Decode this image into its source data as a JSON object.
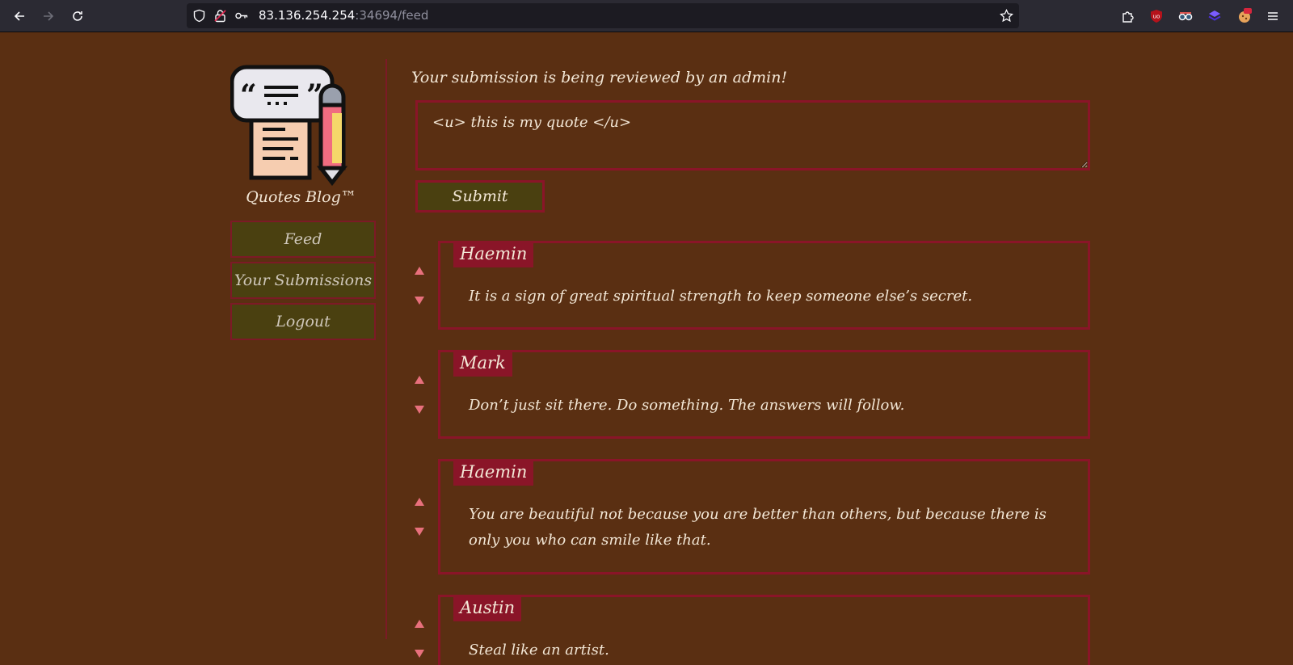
{
  "browser": {
    "url_host": "83.136.254.254",
    "url_path": ":34694/feed"
  },
  "sidebar": {
    "brand": "Quotes Blog™",
    "nav": [
      {
        "label": "Feed"
      },
      {
        "label": "Your Submissions"
      },
      {
        "label": "Logout"
      }
    ]
  },
  "main": {
    "notice": "Your submission is being reviewed by an admin!",
    "quote_value": "<u> this is my quote </u>",
    "submit_label": "Submit",
    "posts": [
      {
        "author": "Haemin",
        "text": "It is a sign of great spiritual strength to keep someone else’s secret."
      },
      {
        "author": "Mark",
        "text": "Don’t just sit there. Do something. The answers will follow."
      },
      {
        "author": "Haemin",
        "text": "You are beautiful not because you are better than others, but because there is only you who can smile like that."
      },
      {
        "author": "Austin",
        "text": "Steal like an artist."
      }
    ]
  },
  "colors": {
    "background": "#5a2f12",
    "accent": "#8a1528",
    "button": "#4a4010",
    "vote_arrow": "#e8707c"
  }
}
